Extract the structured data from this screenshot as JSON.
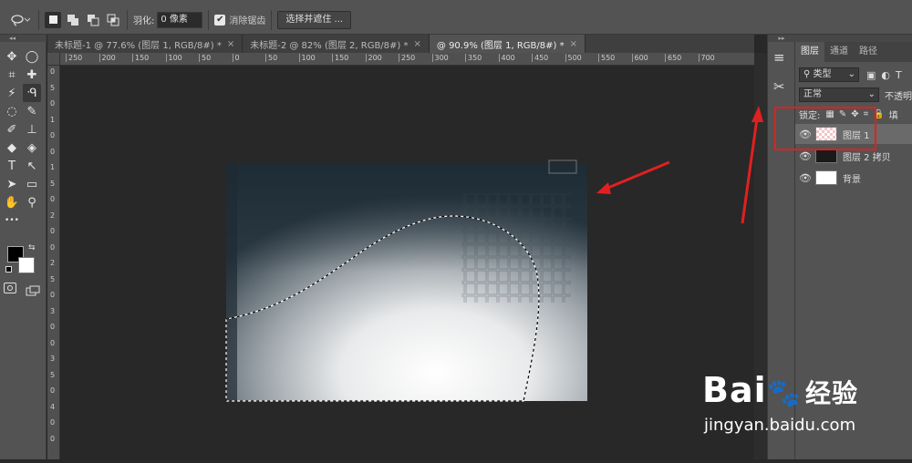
{
  "colors": {
    "panel": "#535353",
    "canvas_bg": "#282828",
    "accent_red": "#e02020",
    "selection": "#ffffff"
  },
  "options_bar": {
    "feather_label": "羽化:",
    "feather_value": "0 像素",
    "antialias_label": "消除锯齿",
    "antialias_checked": true,
    "select_mask_button": "选择并遮住 ..."
  },
  "tabs": [
    {
      "label": "未标题-1 @ 77.6% (图层 1, RGB/8#) *",
      "close": "×",
      "active": false
    },
    {
      "label": "未标题-2 @ 82% (图层 2, RGB/8#) *",
      "close": "×",
      "active": false
    },
    {
      "label": "@ 90.9% (图层 1, RGB/8#) *",
      "close": "×",
      "active": true
    }
  ],
  "ruler": {
    "h_ticks": [
      "250",
      "200",
      "150",
      "100",
      "50",
      "0",
      "50",
      "100",
      "150",
      "200",
      "250",
      "300",
      "350",
      "400",
      "450",
      "500",
      "550",
      "600",
      "650",
      "700"
    ],
    "v_ticks": [
      "0",
      "5",
      "0",
      "1",
      "0",
      "0",
      "1",
      "5",
      "0",
      "2",
      "0",
      "0",
      "2",
      "5",
      "0",
      "3",
      "0",
      "0",
      "3",
      "5",
      "0",
      "4",
      "0",
      "0"
    ]
  },
  "toolbar": {
    "tools": [
      {
        "name": "move-tool",
        "icon": "move-icon",
        "glyph": "✥"
      },
      {
        "name": "marquee-tool",
        "icon": "ellipse-marquee-icon",
        "glyph": "◯"
      },
      {
        "name": "crop-tool",
        "icon": "crop-icon",
        "glyph": "⌗"
      },
      {
        "name": "healing-tool",
        "icon": "bandage-icon",
        "glyph": "✚"
      },
      {
        "name": "magic-wand-tool",
        "icon": "magic-wand-icon",
        "glyph": "⚡"
      },
      {
        "name": "lasso-tool",
        "icon": "lasso-icon",
        "glyph": "ᑴ",
        "active": true
      },
      {
        "name": "quick-select-tool",
        "icon": "quick-select-icon",
        "glyph": "◌"
      },
      {
        "name": "eyedropper-tool",
        "icon": "eyedropper-icon",
        "glyph": "✎"
      },
      {
        "name": "brush-tool",
        "icon": "brush-icon",
        "glyph": "✐"
      },
      {
        "name": "stamp-tool",
        "icon": "stamp-icon",
        "glyph": "⊥"
      },
      {
        "name": "eraser-tool",
        "icon": "eraser-icon",
        "glyph": "◆"
      },
      {
        "name": "paint-bucket-tool",
        "icon": "paint-bucket-icon",
        "glyph": "◈"
      },
      {
        "name": "type-tool",
        "icon": "type-icon",
        "glyph": "T"
      },
      {
        "name": "path-select-tool",
        "icon": "path-select-icon",
        "glyph": "↖"
      },
      {
        "name": "direct-select-tool",
        "icon": "direct-select-icon",
        "glyph": "➤"
      },
      {
        "name": "rectangle-tool",
        "icon": "rectangle-icon",
        "glyph": "▭"
      },
      {
        "name": "hand-tool",
        "icon": "hand-icon",
        "glyph": "✋"
      },
      {
        "name": "zoom-tool",
        "icon": "zoom-icon",
        "glyph": "⚲"
      },
      {
        "name": "more-tools",
        "icon": "ellipsis-icon",
        "glyph": "•••"
      }
    ]
  },
  "layers_panel": {
    "tabs": [
      "图层",
      "通道",
      "路径"
    ],
    "filter_label": "类型",
    "blend_mode": "正常",
    "opacity_label": "不透明",
    "lock_label": "锁定:",
    "fill_label": "填",
    "layers": [
      {
        "name": "图层 1",
        "selected": true,
        "thumb": "transparent"
      },
      {
        "name": "图层 2 拷贝",
        "selected": false,
        "thumb": "dark"
      },
      {
        "name": "背景",
        "selected": false,
        "thumb": "white"
      }
    ]
  },
  "watermark": {
    "text": "Bai",
    "paw": "🐾",
    "du": "经验",
    "url": "jingyan.baidu.com"
  }
}
